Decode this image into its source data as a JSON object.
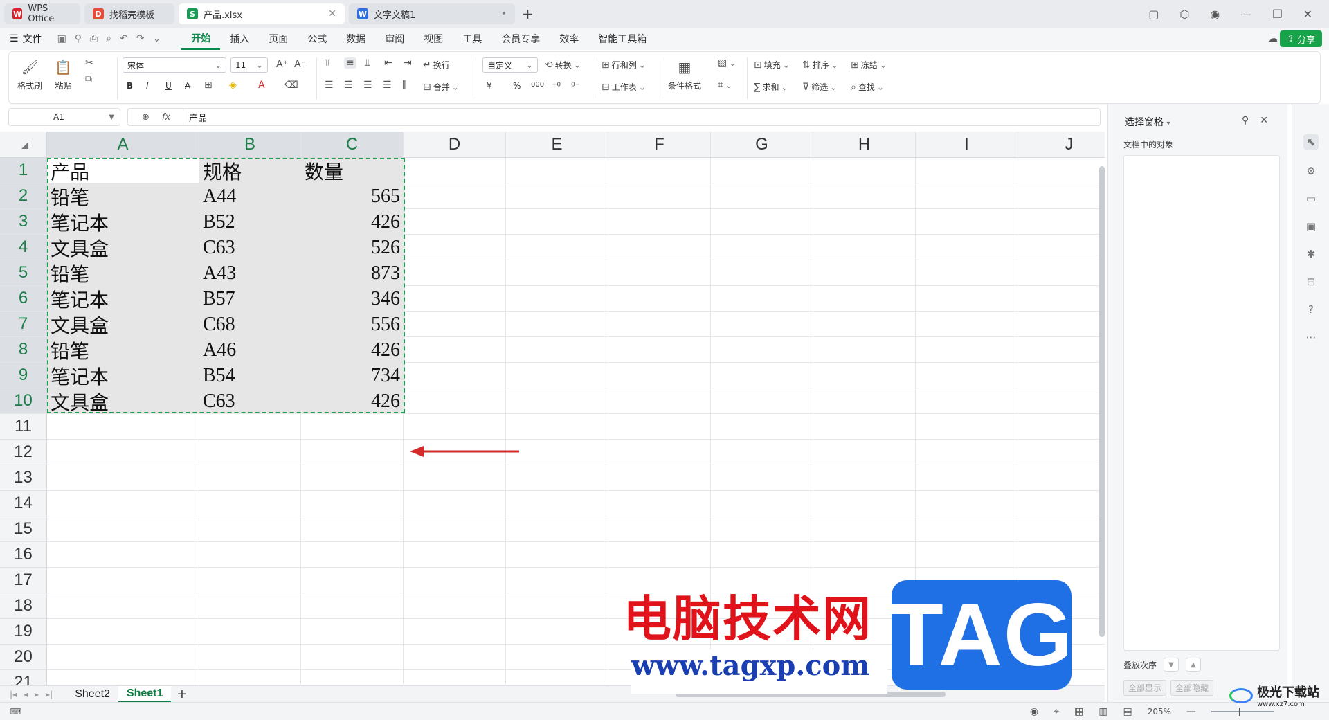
{
  "tabs": [
    {
      "label": "WPS Office",
      "icon": "W",
      "color": "#d9232d"
    },
    {
      "label": "找稻壳模板",
      "icon": "D",
      "color": "#e44d3a"
    },
    {
      "label": "产品.xlsx",
      "icon": "S",
      "color": "#1a9a55"
    },
    {
      "label": "文字文稿1",
      "icon": "W",
      "color": "#2f6ee0"
    }
  ],
  "menu": {
    "file": "文件",
    "tabs": [
      "开始",
      "插入",
      "页面",
      "公式",
      "数据",
      "审阅",
      "视图",
      "工具",
      "会员专享",
      "效率",
      "智能工具箱"
    ],
    "share": "分享"
  },
  "ribbon": {
    "format_painter": "格式刷",
    "paste": "粘贴",
    "font_name": "宋体",
    "font_size": "11",
    "wrap": "换行",
    "merge": "合并",
    "number_format": "自定义",
    "convert": "转换",
    "row_col": "行和列",
    "worksheet": "工作表",
    "cond_format": "条件格式",
    "fill": "填充",
    "sort": "排序",
    "freeze": "冻结",
    "sum": "求和",
    "filter": "筛选",
    "find": "查找",
    "bold": "B",
    "italic": "I",
    "underline": "U",
    "strike": "A",
    "currency": "¥",
    "percent": "%",
    "thousand": "000"
  },
  "formula_bar": {
    "cell_ref": "A1",
    "fx": "fx",
    "value": "产品"
  },
  "sheet": {
    "columns": [
      "A",
      "B",
      "C",
      "D",
      "E",
      "F",
      "G",
      "H",
      "I",
      "J"
    ],
    "row_numbers": [
      "1",
      "2",
      "3",
      "4",
      "5",
      "6",
      "7",
      "8",
      "9",
      "10",
      "11",
      "12",
      "13",
      "14",
      "15",
      "16",
      "17",
      "18",
      "19",
      "20",
      "21"
    ],
    "rows": [
      [
        "产品",
        "规格",
        "数量"
      ],
      [
        "铅笔",
        "A44",
        "565"
      ],
      [
        "笔记本",
        "B52",
        "426"
      ],
      [
        "文具盒",
        "C63",
        "526"
      ],
      [
        "铅笔",
        "A43",
        "873"
      ],
      [
        "笔记本",
        "B57",
        "346"
      ],
      [
        "文具盒",
        "C68",
        "556"
      ],
      [
        "铅笔",
        "A46",
        "426"
      ],
      [
        "笔记本",
        "B54",
        "734"
      ],
      [
        "文具盒",
        "C63",
        "426"
      ]
    ]
  },
  "sheet_tabs": [
    "Sheet2",
    "Sheet1"
  ],
  "active_sheet": "Sheet1",
  "status": {
    "zoom": "205%"
  },
  "selection_pane": {
    "title": "选择窗格",
    "subtitle": "文档中的对象",
    "order_label": "叠放次序",
    "show_all": "全部显示",
    "hide_all": "全部隐藏"
  },
  "watermark": {
    "cn": "电脑技术网",
    "url": "www.tagxp.com",
    "tag": "TAG",
    "site": "极光下载站",
    "site_url": "www.xz7.com"
  },
  "annotation_arrow_color": "#d42a2a"
}
